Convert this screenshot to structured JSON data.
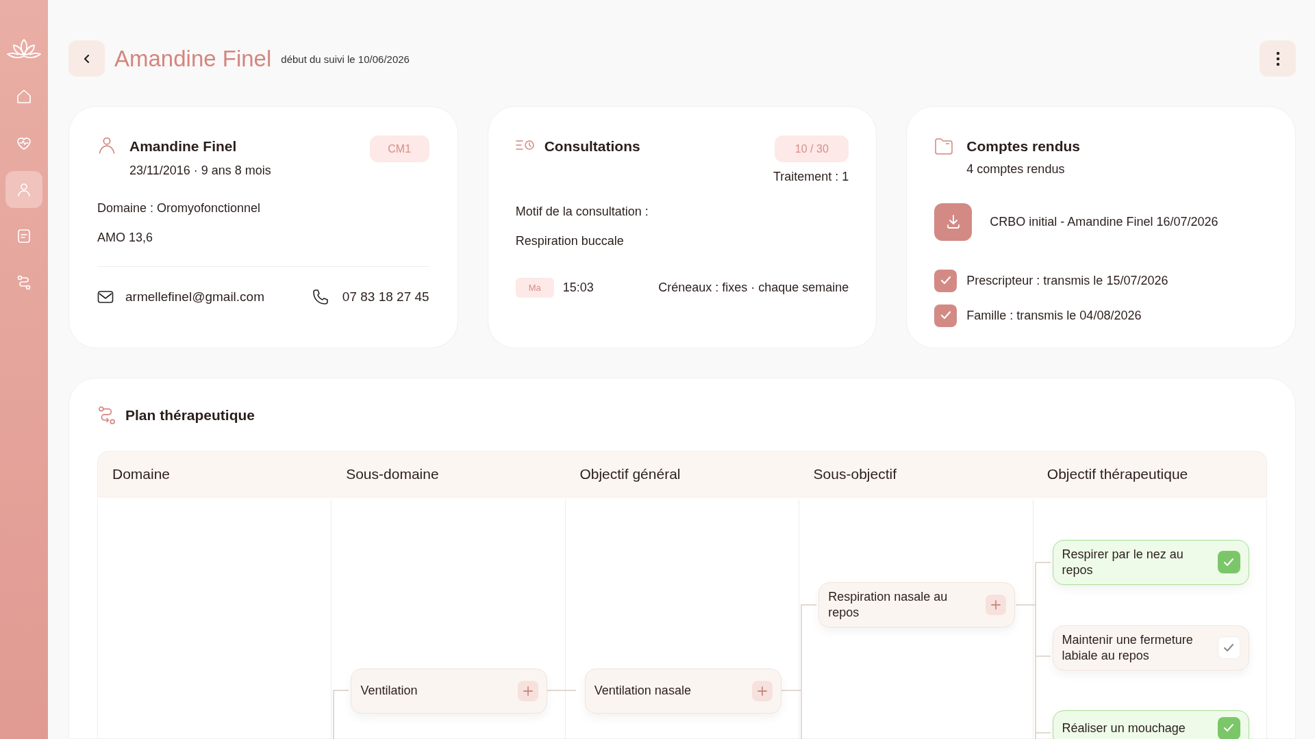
{
  "sidebar": {
    "items": [
      {
        "selected": false
      },
      {
        "selected": false
      },
      {
        "selected": true
      },
      {
        "selected": false
      },
      {
        "selected": false
      }
    ]
  },
  "header": {
    "title": "Amandine Finel",
    "subtitle": "début du suivi le 10/06/2026"
  },
  "patient_card": {
    "name": "Amandine Finel",
    "birth": "23/11/2016 · 9 ans 8 mois",
    "badge": "CM1",
    "domain": "Domaine : Oromyofonctionnel",
    "amo": "AMO 13,6",
    "email": "armellefinel@gmail.com",
    "phone": "07 83 18 27 45"
  },
  "consultations_card": {
    "title": "Consultations",
    "badge": "10 / 30",
    "treatment": "Traitement : 1",
    "reason_label": "Motif de la consultation :",
    "reason": "Respiration buccale",
    "day": "Ma",
    "time": "15:03",
    "slots": "Créneaux : fixes · chaque semaine"
  },
  "reports_card": {
    "title": "Comptes rendus",
    "count": "4 comptes rendus",
    "document": "CRBO initial - Amandine Finel 16/07/2026",
    "transmissions": [
      {
        "label": "Prescripteur : transmis le 15/07/2026",
        "checked": true
      },
      {
        "label": "Famille : transmis le 04/08/2026",
        "checked": true
      }
    ]
  },
  "plan": {
    "title": "Plan thérapeutique",
    "columns": [
      "Domaine",
      "Sous-domaine",
      "Objectif général",
      "Sous-objectif",
      "Objectif thérapeutique"
    ],
    "tree": [
      {
        "label": "Ventilation",
        "children": [
          {
            "label": "Ventilation nasale",
            "children": [
              {
                "label": "Respiration nasale au repos",
                "children": [
                  {
                    "label": "Respirer par le nez au repos",
                    "checked": true
                  },
                  {
                    "label": "Maintenir une fermeture labiale au repos",
                    "checked": false
                  },
                  {
                    "label": "Réaliser un mouchage",
                    "checked": true
                  }
                ]
              }
            ]
          }
        ]
      }
    ]
  }
}
